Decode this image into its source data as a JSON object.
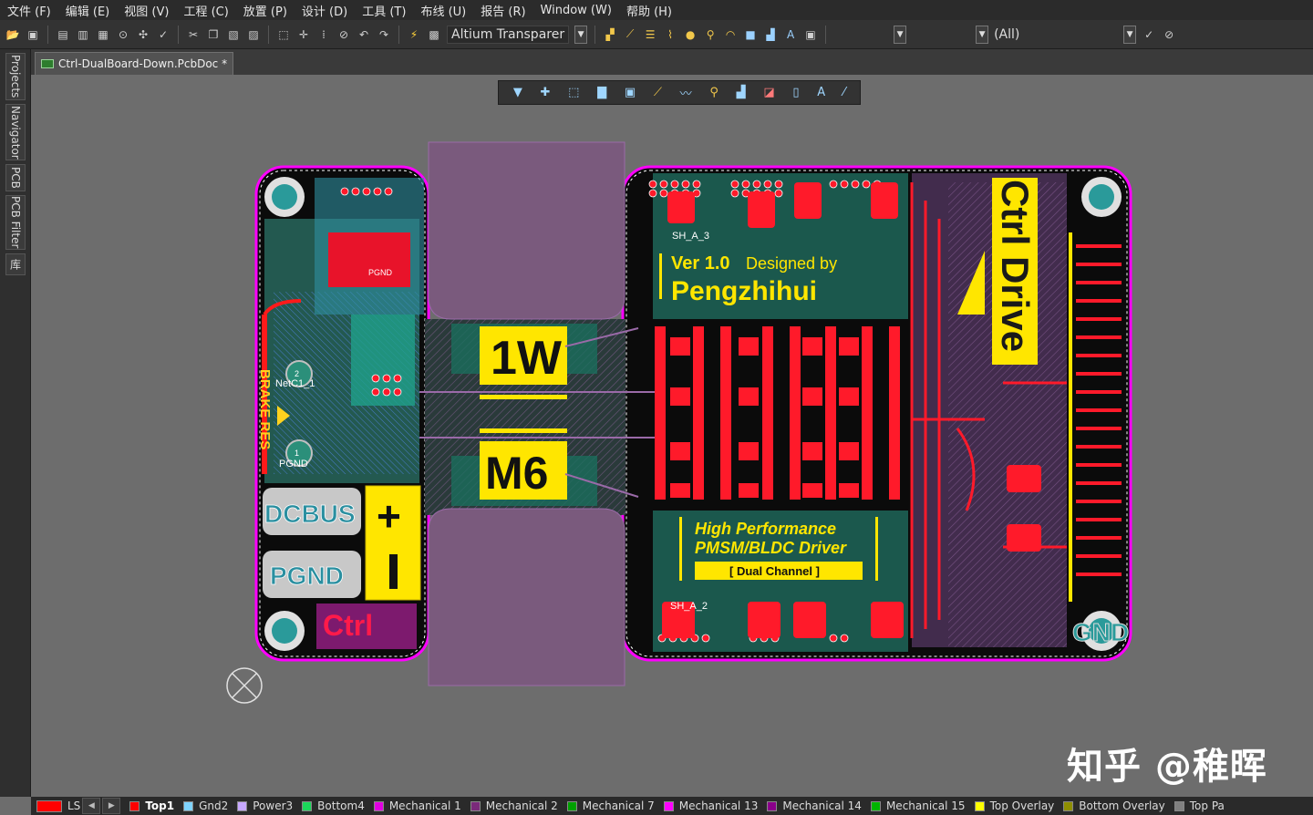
{
  "menu": [
    "文件 (F)",
    "编辑 (E)",
    "视图 (V)",
    "工程 (C)",
    "放置 (P)",
    "设计 (D)",
    "工具 (T)",
    "布线 (U)",
    "报告 (R)",
    "Window (W)",
    "帮助 (H)"
  ],
  "toolbar": {
    "view_config": "Altium Transparer",
    "net_filter": "",
    "class_filter": "(All)"
  },
  "panels": [
    "Projects",
    "Navigator",
    "PCB",
    "PCB Filter",
    "库"
  ],
  "document_tab": "Ctrl-DualBoard-Down.PcbDoc *",
  "board": {
    "title": "Ctrl Drive",
    "version": "Ver 1.0",
    "designed_by": "Designed by",
    "author": "Pengzhihui",
    "tagline1": "High  Performance",
    "tagline2": "PMSM/BLDC Driver",
    "tagline3": "[ Dual Channel ]",
    "label_1w": "1W",
    "label_m6": "M6",
    "brake_res": "BRAKE RES",
    "dcbus": "DCBUS",
    "pgnd": "PGND",
    "plus": "+",
    "minus": "|",
    "ctrl": "Ctrl",
    "gnd": "GND",
    "pad_pgnd": "PGND",
    "netc1": "NetC1_1",
    "pad1_pgnd": "PGND",
    "pad2": "2",
    "pad1": "1",
    "sh_a3": "SH_A_3",
    "sh_a2": "SH_A_2"
  },
  "layers": [
    {
      "name": "LS",
      "color": "#ff0000"
    },
    {
      "name": "Top1",
      "color": "#ff0000",
      "active": true
    },
    {
      "name": "Gnd2",
      "color": "#7fd4ff"
    },
    {
      "name": "Power3",
      "color": "#c7a8ff"
    },
    {
      "name": "Bottom4",
      "color": "#1bd75a"
    },
    {
      "name": "Mechanical 1",
      "color": "#e100e1"
    },
    {
      "name": "Mechanical 2",
      "color": "#7a2a7a"
    },
    {
      "name": "Mechanical 7",
      "color": "#00a000"
    },
    {
      "name": "Mechanical 13",
      "color": "#ff00ff"
    },
    {
      "name": "Mechanical 14",
      "color": "#8a008a"
    },
    {
      "name": "Mechanical 15",
      "color": "#00b400"
    },
    {
      "name": "Top Overlay",
      "color": "#ffff00"
    },
    {
      "name": "Bottom Overlay",
      "color": "#8e8e00"
    },
    {
      "name": "Top Pa",
      "color": "#808080"
    }
  ],
  "watermark": "知乎 @稚晖"
}
